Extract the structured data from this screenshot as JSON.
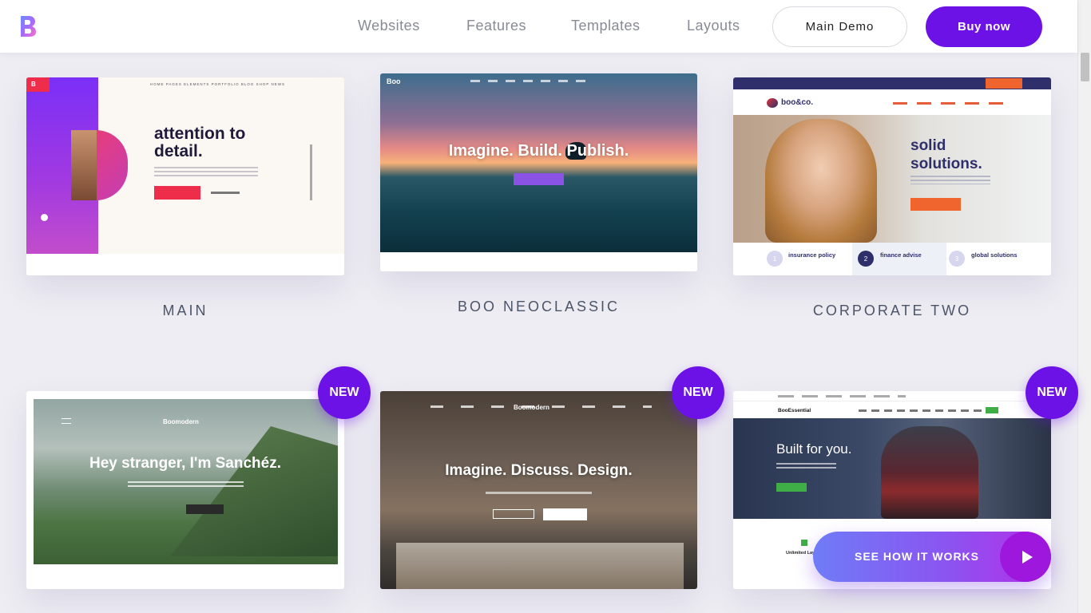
{
  "header": {
    "logo_letter": "B",
    "nav": [
      {
        "label": "Websites"
      },
      {
        "label": "Features"
      },
      {
        "label": "Templates"
      },
      {
        "label": "Layouts"
      }
    ],
    "main_demo_label": "Main Demo",
    "buy_label": "Buy now"
  },
  "colors": {
    "accent": "#6c12e6",
    "background": "#eeedf3"
  },
  "cards": [
    {
      "label": "MAIN",
      "preview": {
        "corner_badge": "B",
        "title_line1": "attention to",
        "title_line2": "detail.",
        "nav": "HOME  PAGES  ELEMENTS  PORTFOLIO  BLOG  SHOP  NEWS"
      }
    },
    {
      "label": "BOO NEOCLASSIC",
      "preview": {
        "logo": "Boo",
        "title": "Imagine. Build. Publish."
      }
    },
    {
      "label": "CORPORATE TWO",
      "preview": {
        "brand": "boo&co.",
        "heading_line1": "solid",
        "heading_line2": "solutions.",
        "features": [
          {
            "num": "1",
            "label": "insurance policy"
          },
          {
            "num": "2",
            "label": "finance advise"
          },
          {
            "num": "3",
            "label": "global solutions"
          }
        ]
      }
    },
    {
      "badge": "NEW",
      "preview": {
        "logo": "Boomodern",
        "title": "Hey stranger, I'm Sanchéz."
      }
    },
    {
      "badge": "NEW",
      "preview": {
        "logo": "Boomodern",
        "title": "Imagine. Discuss. Design."
      }
    },
    {
      "badge": "NEW",
      "preview": {
        "brand": "BooEssential",
        "title": "Built for you.",
        "feature": "Unlimited Lay"
      }
    }
  ],
  "cta": {
    "label": "SEE HOW IT WORKS",
    "icon": "play-icon"
  }
}
